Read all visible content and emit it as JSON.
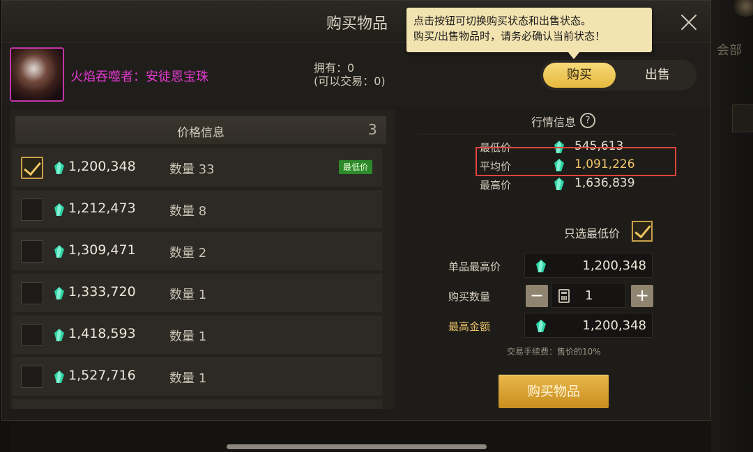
{
  "dialog": {
    "title": "购买物品",
    "tooltip_line1": "点击按钮可切换购买状态和出售状态。",
    "tooltip_line2": "购买/出售物品时，请务必确认当前状态！"
  },
  "background": {
    "side_text": "会部"
  },
  "item": {
    "name": "火焰吞噬者：安徒恩宝珠",
    "owned_line1": "拥有：0",
    "owned_line2": "(可以交易：0)"
  },
  "mode_toggle": {
    "buy_label": "购买",
    "sell_label": "出售",
    "selected": "购买"
  },
  "price_list": {
    "header_label": "价格信息",
    "header_count": "3",
    "lowest_badge": "最低价",
    "rows": [
      {
        "price": "1,200,348",
        "qty": "数量 33",
        "checked": true,
        "lowest": true
      },
      {
        "price": "1,212,473",
        "qty": "数量 8",
        "checked": false,
        "lowest": false
      },
      {
        "price": "1,309,471",
        "qty": "数量 2",
        "checked": false,
        "lowest": false
      },
      {
        "price": "1,333,720",
        "qty": "数量 1",
        "checked": false,
        "lowest": false
      },
      {
        "price": "1,418,593",
        "qty": "数量 1",
        "checked": false,
        "lowest": false
      },
      {
        "price": "1,527,716",
        "qty": "数量 1",
        "checked": false,
        "lowest": false
      }
    ]
  },
  "market": {
    "title": "行情信息",
    "help": "?",
    "lowest_label": "最低价",
    "lowest_value": "545,613",
    "avg_label": "平均价",
    "avg_value": "1,091,226",
    "highest_label": "最高价",
    "highest_value": "1,636,839"
  },
  "purchase_form": {
    "only_lowest_label": "只选最低价",
    "only_lowest_checked": true,
    "max_unit_price_label": "单品最高价",
    "max_unit_price": "1,200,348",
    "quantity_label": "购买数量",
    "quantity": "1",
    "minus": "−",
    "plus": "+",
    "max_total_label": "最高金额",
    "max_total": "1,200,348",
    "fee_note": "交易手续费：售价的10%",
    "buy_button": "购买物品"
  },
  "colors": {
    "item_name": "#e23ad0",
    "gem": "#2fd3a4",
    "accent_gold": "#e6b83e",
    "highlight_red": "#e0443c",
    "badge_green": "#2d8a2a"
  }
}
